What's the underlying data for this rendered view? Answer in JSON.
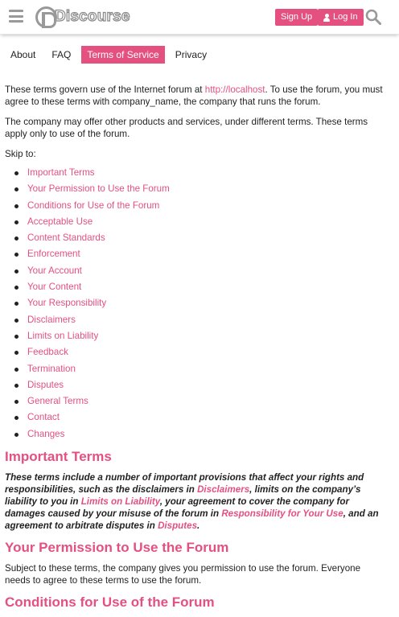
{
  "header": {
    "logo_text": "Discourse",
    "signup_label": "Sign Up",
    "login_label": "Log In"
  },
  "tabs": [
    {
      "label": "About",
      "active": false
    },
    {
      "label": "FAQ",
      "active": false
    },
    {
      "label": "Terms of Service",
      "active": true
    },
    {
      "label": "Privacy",
      "active": false
    }
  ],
  "intro": {
    "p1_before": "These terms govern use of the Internet forum at ",
    "p1_link": "http://localhost",
    "p1_after": ". To use the forum, you must agree to these terms with company_name, the company that runs the forum.",
    "p2": "The company may offer other products and services, under different terms. These terms apply only to use of the forum.",
    "skip_to": "Skip to:"
  },
  "toc": [
    "Important Terms",
    "Your Permission to Use the Forum",
    "Conditions for Use of the Forum",
    "Acceptable Use",
    "Content Standards",
    "Enforcement",
    "Your Account",
    "Your Content",
    "Your Responsibility",
    "Disclaimers",
    "Limits on Liability",
    "Feedback",
    "Termination",
    "Disputes",
    "General Terms",
    "Contact",
    "Changes"
  ],
  "sections": {
    "important": {
      "heading": "Important Terms",
      "t1": "These terms include a number of important provisions that affect your rights and responsibilities, such as the disclaimers in ",
      "l1": "Disclaimers",
      "t2": ", limits on the company’s liability to you in ",
      "l2": "Limits on Liability",
      "t3": ", your agreement to cover the company for damages caused by your misuse of the forum in ",
      "l3": "Responsibility for Your Use",
      "t4": ", and an agreement to arbitrate disputes in ",
      "l4": "Disputes",
      "t5": "."
    },
    "permission": {
      "heading": "Your Permission to Use the Forum",
      "body": "Subject to these terms, the company gives you permission to use the forum. Everyone needs to agree to these terms to use the forum."
    },
    "conditions": {
      "heading": "Conditions for Use of the Forum"
    }
  }
}
